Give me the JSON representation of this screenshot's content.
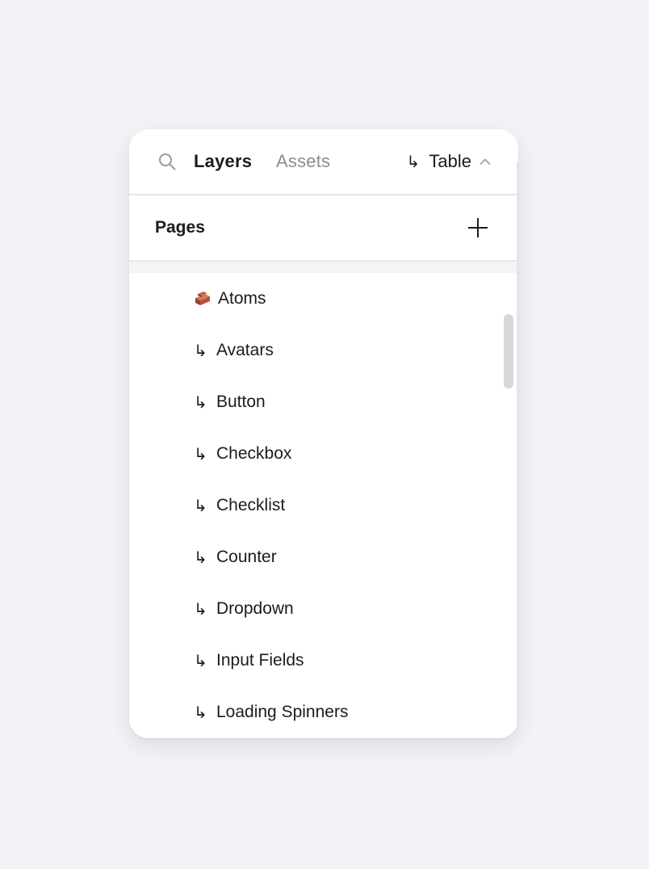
{
  "header": {
    "tabs": [
      {
        "label": "Layers",
        "active": true
      },
      {
        "label": "Assets",
        "active": false
      }
    ],
    "current_page_arrow": "↳",
    "current_page": "Table"
  },
  "pages": {
    "title": "Pages",
    "items": [
      {
        "icon": "brick-icon",
        "prefix": "",
        "label": "Atoms"
      },
      {
        "icon": "return-arrow-icon",
        "prefix": "↳",
        "label": "Avatars"
      },
      {
        "icon": "return-arrow-icon",
        "prefix": "↳",
        "label": "Button"
      },
      {
        "icon": "return-arrow-icon",
        "prefix": "↳",
        "label": "Checkbox"
      },
      {
        "icon": "return-arrow-icon",
        "prefix": "↳",
        "label": "Checklist"
      },
      {
        "icon": "return-arrow-icon",
        "prefix": "↳",
        "label": "Counter"
      },
      {
        "icon": "return-arrow-icon",
        "prefix": "↳",
        "label": "Dropdown"
      },
      {
        "icon": "return-arrow-icon",
        "prefix": "↳",
        "label": "Input Fields"
      },
      {
        "icon": "return-arrow-icon",
        "prefix": "↳",
        "label": "Loading Spinners"
      }
    ]
  },
  "colors": {
    "background": "#f2f3f7",
    "panel": "#ffffff",
    "text": "#1c1c1c",
    "muted": "#8c8c8c",
    "divider": "#e6e6e6",
    "scrollbar": "#d7d7d9",
    "brick": "#b5533a"
  }
}
